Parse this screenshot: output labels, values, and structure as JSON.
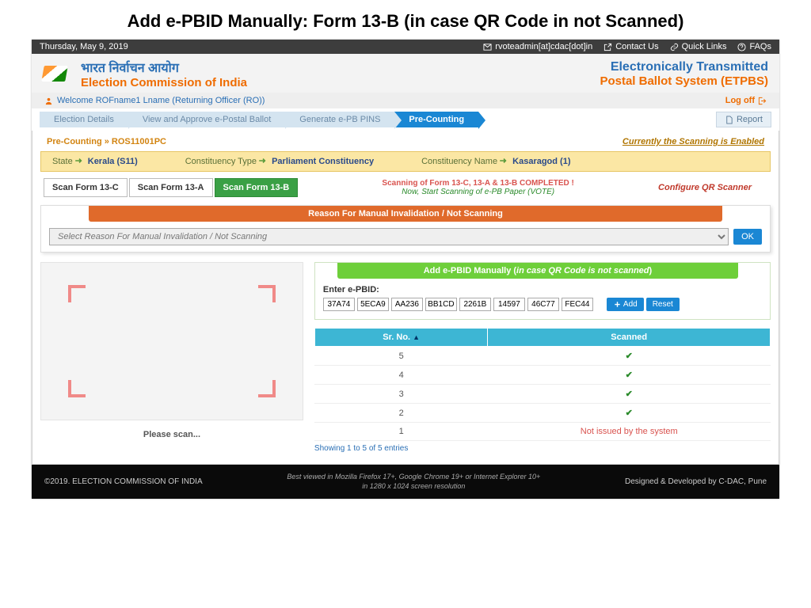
{
  "slide_title": "Add e-PBID Manually: Form 13-B    (in case QR Code in not Scanned)",
  "topbar": {
    "date": "Thursday, May 9, 2019",
    "email": "rvoteadmin[at]cdac[dot]in",
    "contact": "Contact Us",
    "quick": "Quick Links",
    "faqs": "FAQs"
  },
  "header": {
    "hindi": "भारत निर्वाचन आयोग",
    "eng": "Election Commission of India",
    "et": "Electronically Transmitted",
    "pb": "Postal Ballot System (ETPBS)"
  },
  "welcome": {
    "text": "Welcome ROFname1 Lname (Returning Officer (RO))",
    "logoff": "Log off"
  },
  "nav": {
    "t1": "Election Details",
    "t2": "View and Approve e-Postal Ballot",
    "t3": "Generate e-PB PINS",
    "t4": "Pre-Counting",
    "report": "Report"
  },
  "bc": {
    "path": "Pre-Counting » ROS11001PC",
    "status": "Currently the Scanning is Enabled"
  },
  "meta": {
    "state_lbl": "State",
    "state_val": "Kerala  (S11)",
    "ctype_lbl": "Constituency Type",
    "ctype_val": "Parliament Constituency",
    "cname_lbl": "Constituency Name",
    "cname_val": "Kasaragod  (1)"
  },
  "ftabs": {
    "t1": "Scan Form 13-C",
    "t2": "Scan Form 13-A",
    "t3": "Scan Form 13-B",
    "msg1": "Scanning of Form 13-C, 13-A & 13-B COMPLETED !",
    "msg2": "Now, Start Scanning of e-PB Paper (VOTE)",
    "cfg": "Configure QR Scanner"
  },
  "reason": {
    "head": "Reason For Manual Invalidation / Not Scanning",
    "placeholder": "Select Reason For Manual Invalidation / Not Scanning",
    "ok": "OK"
  },
  "scanpanel": {
    "please": "Please scan..."
  },
  "addpanel": {
    "head_pre": "Add e-PBID Manually (",
    "head_em": "in case QR Code is not scanned",
    "head_post": ")",
    "enter_lbl": "Enter e-PBID:",
    "fields": [
      "37A74",
      "5ECA9",
      "AA236",
      "BB1CD",
      "2261B",
      "14597",
      "46C77",
      "FEC44"
    ],
    "add_btn": "Add",
    "reset_btn": "Reset"
  },
  "table": {
    "h1": "Sr. No.",
    "h2": "Scanned",
    "rows": [
      {
        "sr": "5",
        "status": "ok"
      },
      {
        "sr": "4",
        "status": "ok"
      },
      {
        "sr": "3",
        "status": "ok"
      },
      {
        "sr": "2",
        "status": "ok"
      },
      {
        "sr": "1",
        "status": "Not issued by the system"
      }
    ],
    "info": "Showing 1 to 5 of 5 entries"
  },
  "footer": {
    "left": "©2019. ELECTION COMMISSION OF INDIA",
    "mid1": "Best viewed in Mozilla Firefox 17+, Google Chrome 19+ or Internet Explorer 10+",
    "mid2": "in 1280 x 1024 screen resolution",
    "right": "Designed & Developed by C-DAC, Pune"
  }
}
